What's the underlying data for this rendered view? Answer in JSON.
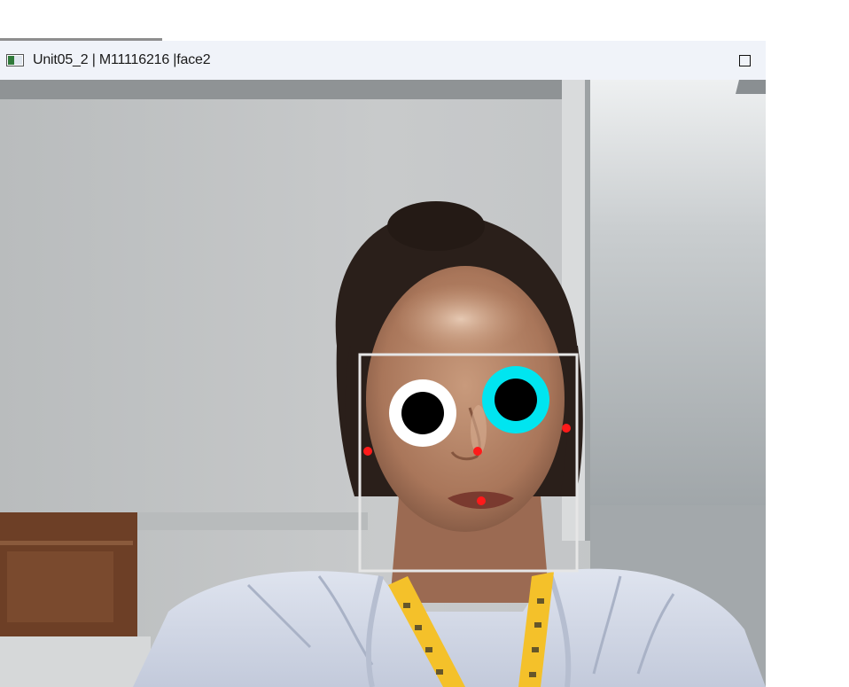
{
  "window": {
    "title": "Unit05_2 | M11116216 |face2",
    "maximize_icon": "maximize-icon"
  },
  "overlay": {
    "face_box_color": "#e6e6e6",
    "left_eye_ring_color": "#ffffff",
    "right_eye_ring_color": "#00e5f0",
    "pupil_color": "#000000",
    "landmark_color": "#ff1a1a"
  }
}
